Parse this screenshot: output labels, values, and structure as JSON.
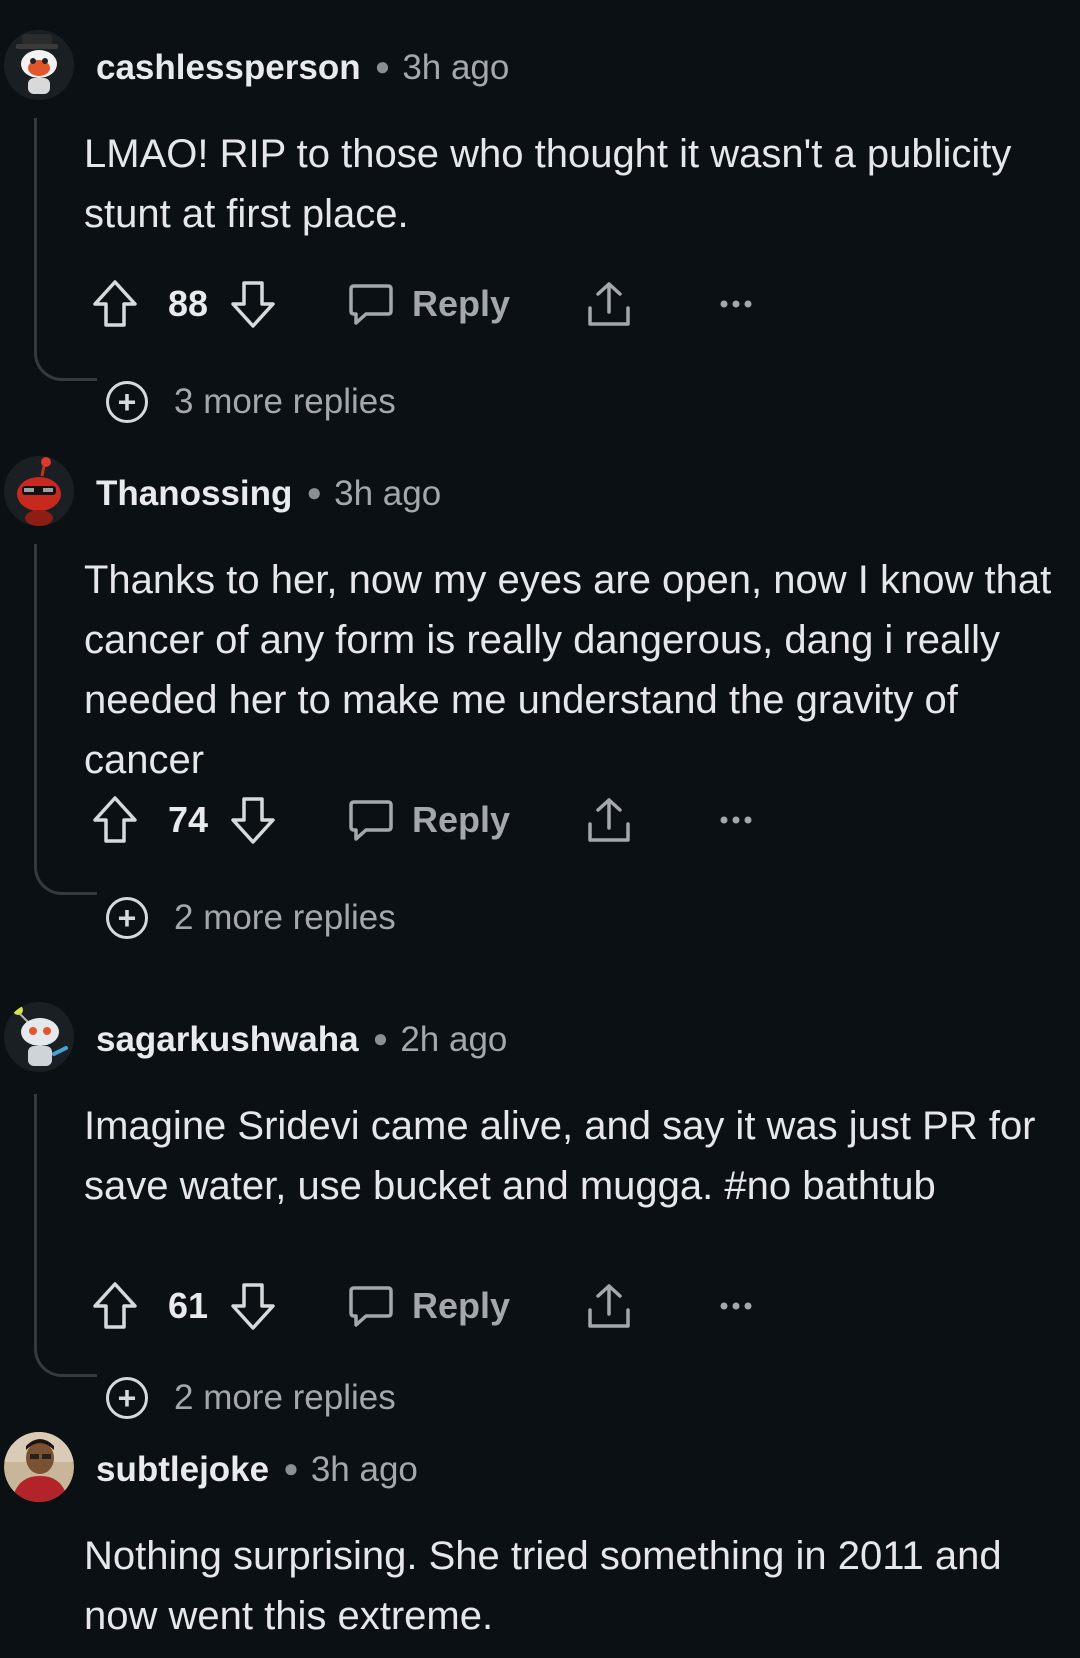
{
  "comments": [
    {
      "username": "cashlessperson",
      "time": "3h ago",
      "text": "LMAO! RIP to those who thought it wasn't a publicity stunt at first place.",
      "score": "88",
      "reply_label": "Reply",
      "more_replies": "3 more replies",
      "avatar_icon": "snoo-avatar-hat-icon"
    },
    {
      "username": "Thanossing",
      "time": "3h ago",
      "text": "Thanks to her, now my eyes are open, now I know that cancer of any form is really dangerous, dang i really needed her to make me understand the gravity of cancer",
      "score": "74",
      "reply_label": "Reply",
      "more_replies": "2 more replies",
      "avatar_icon": "snoo-avatar-red-sunglasses-icon"
    },
    {
      "username": "sagarkushwaha",
      "time": "2h ago",
      "text": "Imagine Sridevi came alive, and say it was just PR for save water, use bucket and mugga. #no bathtub",
      "score": "61",
      "reply_label": "Reply",
      "more_replies": "2 more replies",
      "avatar_icon": "snoo-avatar-robot-icon"
    },
    {
      "username": "subtlejoke",
      "time": "3h ago",
      "text": "Nothing surprising. She tried something in 2011 and now went this extreme.",
      "avatar_icon": "user-photo-avatar"
    }
  ],
  "icons": {
    "upvote": "upvote-arrow-icon",
    "downvote": "downvote-arrow-icon",
    "reply": "speech-bubble-icon",
    "share": "share-upload-icon",
    "overflow": "ellipsis-icon",
    "expand": "plus-circle-icon"
  },
  "colors": {
    "background": "#0b1014",
    "text": "#e5e7ea",
    "muted": "#a4a8ac",
    "thread_line": "#343a40"
  }
}
